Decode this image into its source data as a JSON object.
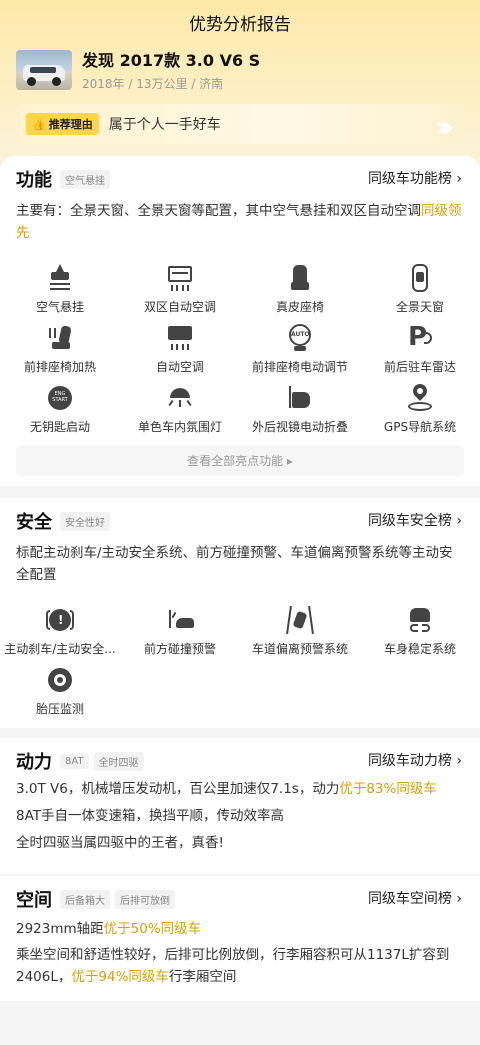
{
  "page": {
    "title": "优势分析报告"
  },
  "car": {
    "name": "发现 2017款 3.0 V6 S",
    "meta": "2018年 / 13万公里 / 济南"
  },
  "reason": {
    "tag": "推荐理由",
    "text": "属于个人一手好车"
  },
  "function": {
    "title": "功能",
    "chip": "空气悬挂",
    "rank": "同级车功能榜 ›",
    "desc_pre": "主要有：全景天窗、全景天窗等配置，其中空气悬挂和双区自动空调",
    "desc_hl": "同级领先",
    "features": [
      {
        "label": "空气悬挂",
        "icon": "air-suspension-icon"
      },
      {
        "label": "双区自动空调",
        "icon": "dual-zone-ac-icon"
      },
      {
        "label": "真皮座椅",
        "icon": "leather-seat-icon"
      },
      {
        "label": "全景天窗",
        "icon": "panoramic-sunroof-icon"
      },
      {
        "label": "前排座椅加热",
        "icon": "seat-heating-icon"
      },
      {
        "label": "自动空调",
        "icon": "auto-ac-icon"
      },
      {
        "label": "前排座椅电动调节",
        "icon": "power-seat-icon"
      },
      {
        "label": "前后驻车雷达",
        "icon": "parking-radar-icon"
      },
      {
        "label": "无钥匙启动",
        "icon": "keyless-start-icon"
      },
      {
        "label": "单色车内氛围灯",
        "icon": "ambient-light-icon"
      },
      {
        "label": "外后视镜电动折叠",
        "icon": "mirror-fold-icon"
      },
      {
        "label": "GPS导航系统",
        "icon": "gps-icon"
      }
    ],
    "all_link": "查看全部亮点功能 ▸"
  },
  "safety": {
    "title": "安全",
    "chip": "安全性好",
    "rank": "同级车安全榜 ›",
    "desc": "标配主动刹车/主动安全系统、前方碰撞预警、车道偏离预警系统等主动安全配置",
    "features": [
      {
        "label": "主动刹车/主动安全...",
        "icon": "active-brake-icon"
      },
      {
        "label": "前方碰撞预警",
        "icon": "collision-warning-icon"
      },
      {
        "label": "车道偏离预警系统",
        "icon": "lane-departure-icon"
      },
      {
        "label": "车身稳定系统",
        "icon": "stability-icon"
      },
      {
        "label": "胎压监测",
        "icon": "tire-pressure-icon"
      }
    ]
  },
  "power": {
    "title": "动力",
    "chips": [
      "8AT",
      "全时四驱"
    ],
    "rank": "同级车动力榜 ›",
    "line1_pre": "3.0T V6，机械增压发动机，百公里加速仅7.1s，动力",
    "line1_hl": "优于83%同级车",
    "line2": "8AT手自一体变速箱，换挡平顺，传动效率高",
    "line3": "全时四驱当属四驱中的王者，真香!"
  },
  "space": {
    "title": "空间",
    "chips": [
      "后备箱大",
      "后排可放倒"
    ],
    "rank": "同级车空间榜 ›",
    "line1_pre": "2923mm轴距",
    "line1_hl": "优于50%同级车",
    "line2": "乘坐空间和舒适性较好，后排可比例放倒，行李厢容积可从1137L扩容到2406L，",
    "line2_hl": "优于94%同级车",
    "line2_post": "行李厢空间"
  }
}
